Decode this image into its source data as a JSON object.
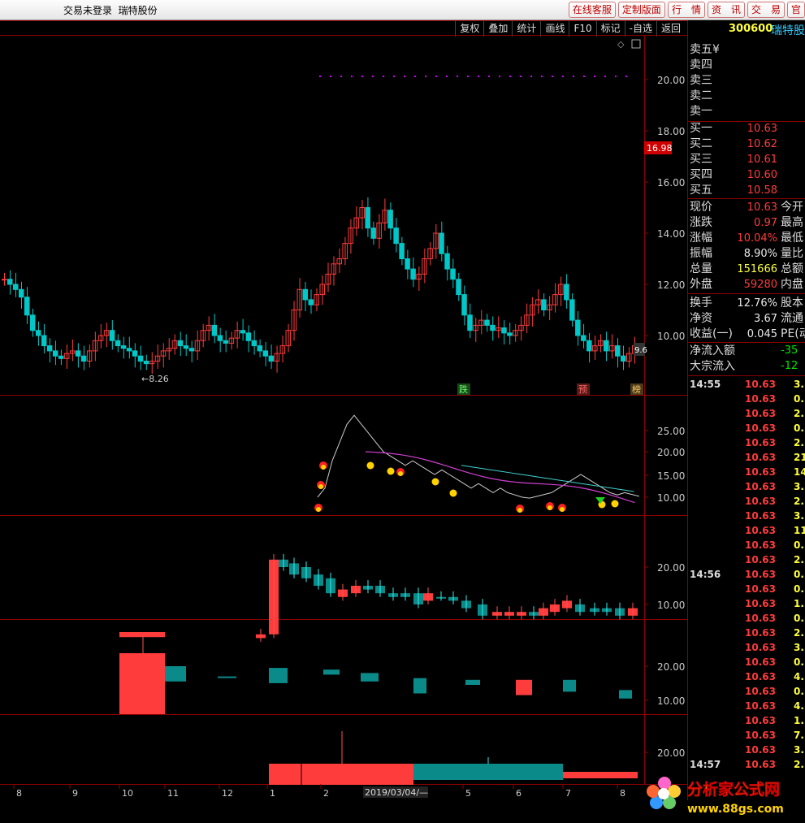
{
  "titlebar": {
    "status": "交易未登录",
    "stock": "瑞特股份",
    "buttons": [
      "在线客服",
      "定制版面",
      "行　情",
      "资　讯",
      "交　易",
      "官"
    ]
  },
  "toolbar": [
    "复权",
    "叠加",
    "统计",
    "画线",
    "F10",
    "标记",
    "-自选",
    "返回"
  ],
  "price_axis": {
    "ticks": [
      "20.00",
      "18.00",
      "16.00",
      "14.00",
      "12.00",
      "10.00"
    ],
    "current_badge": "16.98",
    "last_tag": "9.6",
    "low_marker": "8.26"
  },
  "markers": {
    "m1": "跌",
    "m2": "预",
    "m3": "榜"
  },
  "ind1_ticks": [
    "25.00",
    "20.00",
    "15.00",
    "10.00"
  ],
  "ind2_ticks": [
    "20.00",
    "10.00"
  ],
  "ind3_ticks": [
    "20.00",
    "10.00"
  ],
  "ind4_ticks": [
    "20.00"
  ],
  "xaxis": {
    "labels": [
      "8",
      "9",
      "10",
      "11",
      "12",
      "1",
      "2",
      "5",
      "6",
      "7",
      "8"
    ],
    "cursor_date": "2019/03/04/—"
  },
  "quote": {
    "code": "300600",
    "name": "瑞特股",
    "sell": [
      {
        "label": "卖五",
        "val": "¥"
      },
      {
        "label": "卖四",
        "val": ""
      },
      {
        "label": "卖三",
        "val": ""
      },
      {
        "label": "卖二",
        "val": ""
      },
      {
        "label": "卖一",
        "val": ""
      }
    ],
    "buy": [
      {
        "label": "买一",
        "val": "10.63"
      },
      {
        "label": "买二",
        "val": "10.62"
      },
      {
        "label": "买三",
        "val": "10.61"
      },
      {
        "label": "买四",
        "val": "10.60"
      },
      {
        "label": "买五",
        "val": "10.58"
      }
    ],
    "stats": [
      {
        "label": "现价",
        "val": "10.63",
        "cls": "red",
        "r": "今开"
      },
      {
        "label": "涨跌",
        "val": "0.97",
        "cls": "red",
        "r": "最高"
      },
      {
        "label": "涨幅",
        "val": "10.04%",
        "cls": "red",
        "r": "最低"
      },
      {
        "label": "振幅",
        "val": "8.90%",
        "cls": "wht",
        "r": "量比"
      },
      {
        "label": "总量",
        "val": "151666",
        "cls": "yel",
        "r": "总额"
      },
      {
        "label": "外盘",
        "val": "59280",
        "cls": "red",
        "r": "内盘"
      },
      {
        "label": "换手",
        "val": "12.76%",
        "cls": "wht",
        "r": "股本"
      },
      {
        "label": "净资",
        "val": "3.67",
        "cls": "wht",
        "r": "流通"
      },
      {
        "label": "收益(一)",
        "val": "0.045",
        "cls": "wht",
        "r": "PE(动"
      }
    ],
    "flow": [
      {
        "label": "净流入额",
        "val": "-35"
      },
      {
        "label": "大宗流入",
        "val": "-12"
      }
    ],
    "ticks": [
      {
        "t": "14:55",
        "p": "10.63",
        "v": "3."
      },
      {
        "t": "",
        "p": "10.63",
        "v": "0."
      },
      {
        "t": "",
        "p": "10.63",
        "v": "2."
      },
      {
        "t": "",
        "p": "10.63",
        "v": "0."
      },
      {
        "t": "",
        "p": "10.63",
        "v": "2."
      },
      {
        "t": "",
        "p": "10.63",
        "v": "21."
      },
      {
        "t": "",
        "p": "10.63",
        "v": "14."
      },
      {
        "t": "",
        "p": "10.63",
        "v": "3."
      },
      {
        "t": "",
        "p": "10.63",
        "v": "2."
      },
      {
        "t": "",
        "p": "10.63",
        "v": "3."
      },
      {
        "t": "",
        "p": "10.63",
        "v": "11."
      },
      {
        "t": "",
        "p": "10.63",
        "v": "0."
      },
      {
        "t": "",
        "p": "10.63",
        "v": "2."
      },
      {
        "t": "14:56",
        "p": "10.63",
        "v": "0."
      },
      {
        "t": "",
        "p": "10.63",
        "v": "0."
      },
      {
        "t": "",
        "p": "10.63",
        "v": "1."
      },
      {
        "t": "",
        "p": "10.63",
        "v": "0."
      },
      {
        "t": "",
        "p": "10.63",
        "v": "2."
      },
      {
        "t": "",
        "p": "10.63",
        "v": "3."
      },
      {
        "t": "",
        "p": "10.63",
        "v": "0."
      },
      {
        "t": "",
        "p": "10.63",
        "v": "4."
      },
      {
        "t": "",
        "p": "10.63",
        "v": "0."
      },
      {
        "t": "",
        "p": "10.63",
        "v": "4."
      },
      {
        "t": "",
        "p": "10.63",
        "v": "1."
      },
      {
        "t": "",
        "p": "10.63",
        "v": "7."
      },
      {
        "t": "",
        "p": "10.63",
        "v": "3."
      },
      {
        "t": "14:57",
        "p": "10.63",
        "v": "2."
      }
    ]
  },
  "logo": {
    "name": "分析家公式网",
    "url": "www.88gs.com"
  },
  "colors": {
    "up": "#ff3c3c",
    "down": "#00c8c8",
    "frame": "#8b0000",
    "accent": "#ff0000"
  }
}
